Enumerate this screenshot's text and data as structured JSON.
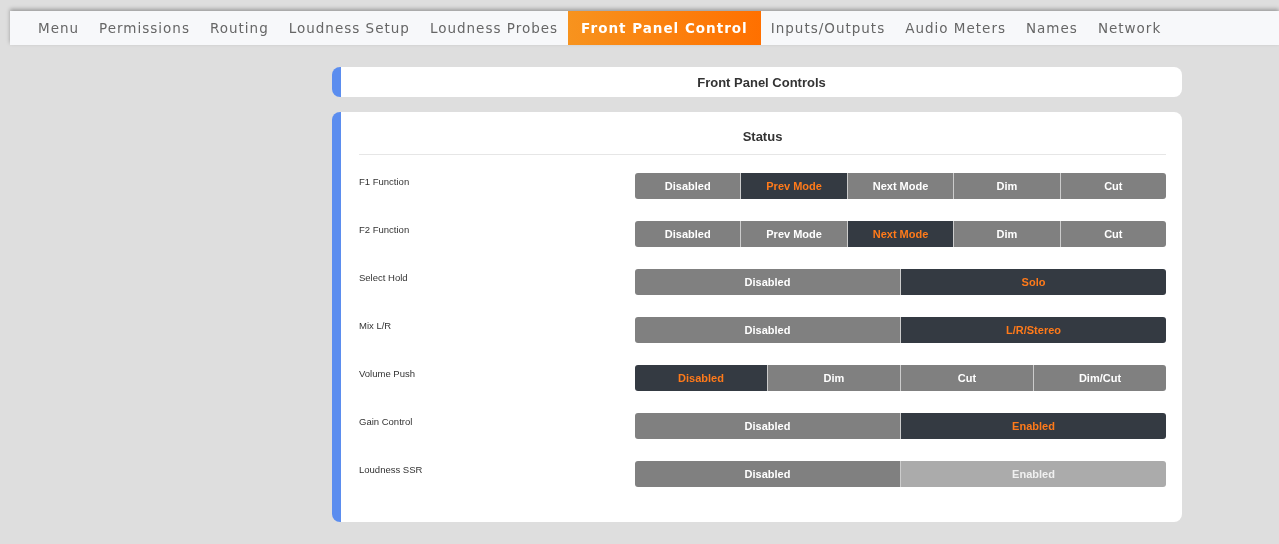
{
  "tabs": [
    {
      "label": "Menu",
      "selected": false
    },
    {
      "label": "Permissions",
      "selected": false
    },
    {
      "label": "Routing",
      "selected": false
    },
    {
      "label": "Loudness Setup",
      "selected": false
    },
    {
      "label": "Loudness Probes",
      "selected": false
    },
    {
      "label": "Front Panel Control",
      "selected": true
    },
    {
      "label": "Inputs/Outputs",
      "selected": false
    },
    {
      "label": "Audio Meters",
      "selected": false
    },
    {
      "label": "Names",
      "selected": false
    },
    {
      "label": "Network",
      "selected": false
    }
  ],
  "header": {
    "title": "Front Panel Controls"
  },
  "status": {
    "title": "Status",
    "settings": [
      {
        "label": "F1 Function",
        "options": [
          {
            "label": "Disabled",
            "selected": false,
            "disabled": false
          },
          {
            "label": "Prev Mode",
            "selected": true,
            "disabled": false
          },
          {
            "label": "Next Mode",
            "selected": false,
            "disabled": false
          },
          {
            "label": "Dim",
            "selected": false,
            "disabled": false
          },
          {
            "label": "Cut",
            "selected": false,
            "disabled": false
          }
        ]
      },
      {
        "label": "F2 Function",
        "options": [
          {
            "label": "Disabled",
            "selected": false,
            "disabled": false
          },
          {
            "label": "Prev Mode",
            "selected": false,
            "disabled": false
          },
          {
            "label": "Next Mode",
            "selected": true,
            "disabled": false
          },
          {
            "label": "Dim",
            "selected": false,
            "disabled": false
          },
          {
            "label": "Cut",
            "selected": false,
            "disabled": false
          }
        ]
      },
      {
        "label": "Select Hold",
        "options": [
          {
            "label": "Disabled",
            "selected": false,
            "disabled": false
          },
          {
            "label": "Solo",
            "selected": true,
            "disabled": false
          }
        ]
      },
      {
        "label": "Mix L/R",
        "options": [
          {
            "label": "Disabled",
            "selected": false,
            "disabled": false
          },
          {
            "label": "L/R/Stereo",
            "selected": true,
            "disabled": false
          }
        ]
      },
      {
        "label": "Volume Push",
        "options": [
          {
            "label": "Disabled",
            "selected": true,
            "disabled": false
          },
          {
            "label": "Dim",
            "selected": false,
            "disabled": false
          },
          {
            "label": "Cut",
            "selected": false,
            "disabled": false
          },
          {
            "label": "Dim/Cut",
            "selected": false,
            "disabled": false
          }
        ]
      },
      {
        "label": "Gain Control",
        "options": [
          {
            "label": "Disabled",
            "selected": false,
            "disabled": false
          },
          {
            "label": "Enabled",
            "selected": true,
            "disabled": false
          }
        ]
      },
      {
        "label": "Loudness SSR",
        "options": [
          {
            "label": "Disabled",
            "selected": false,
            "disabled": false
          },
          {
            "label": "Enabled",
            "selected": false,
            "disabled": true
          }
        ]
      }
    ]
  }
}
